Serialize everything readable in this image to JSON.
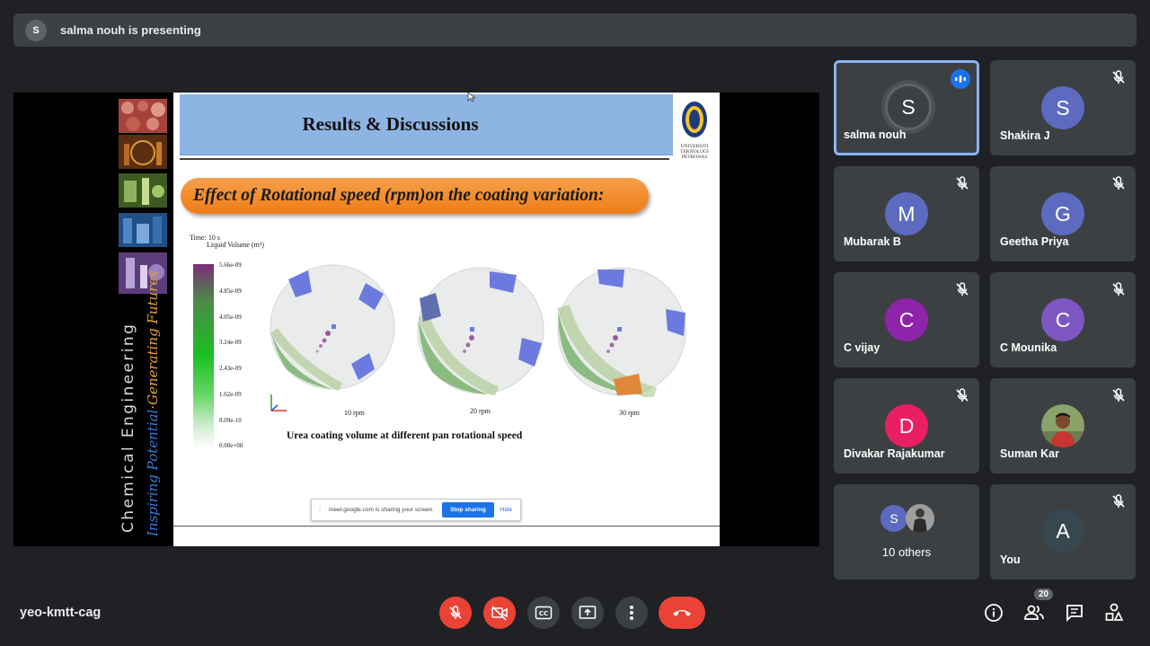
{
  "topbar": {
    "presenter_initial": "S",
    "presenting_text": "salma nouh is presenting"
  },
  "slide": {
    "title": "Results & Discussions",
    "logo_text": "UNIVERSITI TEKNOLOGI PETRONAS",
    "side_text_1": "Chemical Engineering",
    "side_text_2a": "Inspiring Potential",
    "side_text_2b": "·Generating Futures",
    "banner": "Effect of Rotational speed  (rpm)on the coating variation:",
    "time_label": "Time: 10 s",
    "liquid_volume_label": "Liquid Volume (m³)",
    "colorbar_ticks": [
      "5.66e-09",
      "4.85e-09",
      "4.05e-09",
      "3.24e-09",
      "2.43e-09",
      "1.62e-09",
      "8.09e-10",
      "0.00e+00"
    ],
    "rpm_labels": [
      "10 rpm",
      "20 rpm",
      "30 rpm"
    ],
    "figure_caption": "Urea coating volume at different pan rotational speed"
  },
  "share_bar": {
    "text": "meet.google.com is sharing your screen.",
    "stop_label": "Stop sharing",
    "hide_label": "Hide"
  },
  "participants": [
    {
      "name": "salma nouh",
      "initial": "S",
      "color": "#3c4043",
      "muted": false,
      "speaking": true
    },
    {
      "name": "Shakira J",
      "initial": "S",
      "color": "#5c6bc0",
      "muted": true
    },
    {
      "name": "Mubarak B",
      "initial": "M",
      "color": "#5c6bc0",
      "muted": true
    },
    {
      "name": "Geetha Priya",
      "initial": "G",
      "color": "#5c6bc0",
      "muted": true
    },
    {
      "name": "C vijay",
      "initial": "C",
      "color": "#8e24aa",
      "muted": true
    },
    {
      "name": "C Mounika",
      "initial": "C",
      "color": "#7e57c2",
      "muted": true
    },
    {
      "name": "Divakar Rajakumar",
      "initial": "D",
      "color": "#e91e63",
      "muted": true
    },
    {
      "name": "Suman Kar",
      "initial": "",
      "color": "#555555",
      "muted": true,
      "photo": true
    },
    {
      "name": "10 others",
      "initial": "S",
      "color": "#5c6bc0",
      "muted": false
    },
    {
      "name": "You",
      "initial": "A",
      "color": "#37474f",
      "muted": true
    }
  ],
  "bottom": {
    "meeting_code": "yeo-kmtt-cag",
    "participant_count": "20"
  },
  "colors": {
    "accent": "#1a73e8",
    "danger": "#ea4335",
    "bg": "#202124",
    "tile": "#3c4043"
  }
}
